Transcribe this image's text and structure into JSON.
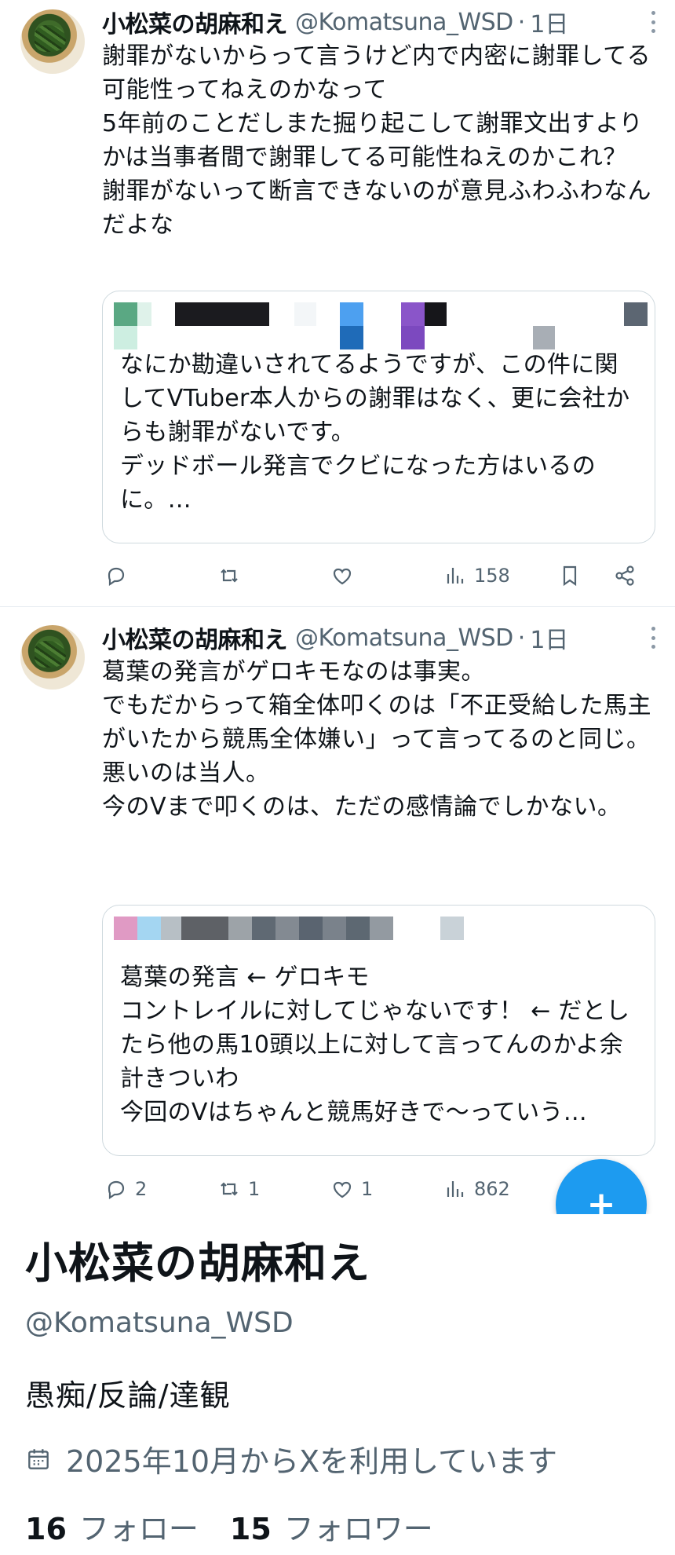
{
  "tweets": [
    {
      "name": "小松菜の胡麻和え",
      "handle": "@Komatsuna_WSD",
      "time": "1日",
      "text": "謝罪がないからって言うけど内で内密に謝罪してる可能性ってねえのかなって\n5年前のことだしまた掘り起こして謝罪文出すよりかは当事者間で謝罪してる可能性ねえのかこれ？\n謝罪がないって断言できないのが意見ふわふわなんだよな",
      "quote_text": "なにか勘違いされてるようですが、この件に関してVTuber本人からの謝罪はなく、更に会社からも謝罪がないです。\nデッドボール発言でクビになった方はいるのに。…",
      "actions": {
        "reply": "",
        "retweet": "",
        "like": "",
        "views": "158"
      }
    },
    {
      "name": "小松菜の胡麻和え",
      "handle": "@Komatsuna_WSD",
      "time": "1日",
      "text": "葛葉の発言がゲロキモなのは事実。\nでもだからって箱全体叩くのは「不正受給した馬主がいたから競馬全体嫌い」って言ってるのと同じ。\n悪いのは当人。\n今のVまで叩くのは、ただの感情論でしかない。",
      "quote_text": "葛葉の発言 ← ゲロキモ\nコントレイルに対してじゃないです！ ← だとしたら他の馬10頭以上に対して言ってんのかよ余計きついわ\n今回のVはちゃんと競馬好きで〜っていう…",
      "actions": {
        "reply": "2",
        "retweet": "1",
        "like": "1",
        "views": "862"
      }
    }
  ],
  "fab": {
    "label": "+"
  },
  "profile": {
    "name": "小松菜の胡麻和え",
    "handle": "@Komatsuna_WSD",
    "bio": "愚痴/反論/達観",
    "joined": "2025年10月からXを利用しています",
    "following_count": "16",
    "following_label": "フォロー",
    "followers_count": "15",
    "followers_label": "フォロワー"
  },
  "colors": {
    "accent": "#1d9bf0",
    "text": "#0f1419",
    "muted": "#536471",
    "border": "#cfd9de"
  }
}
